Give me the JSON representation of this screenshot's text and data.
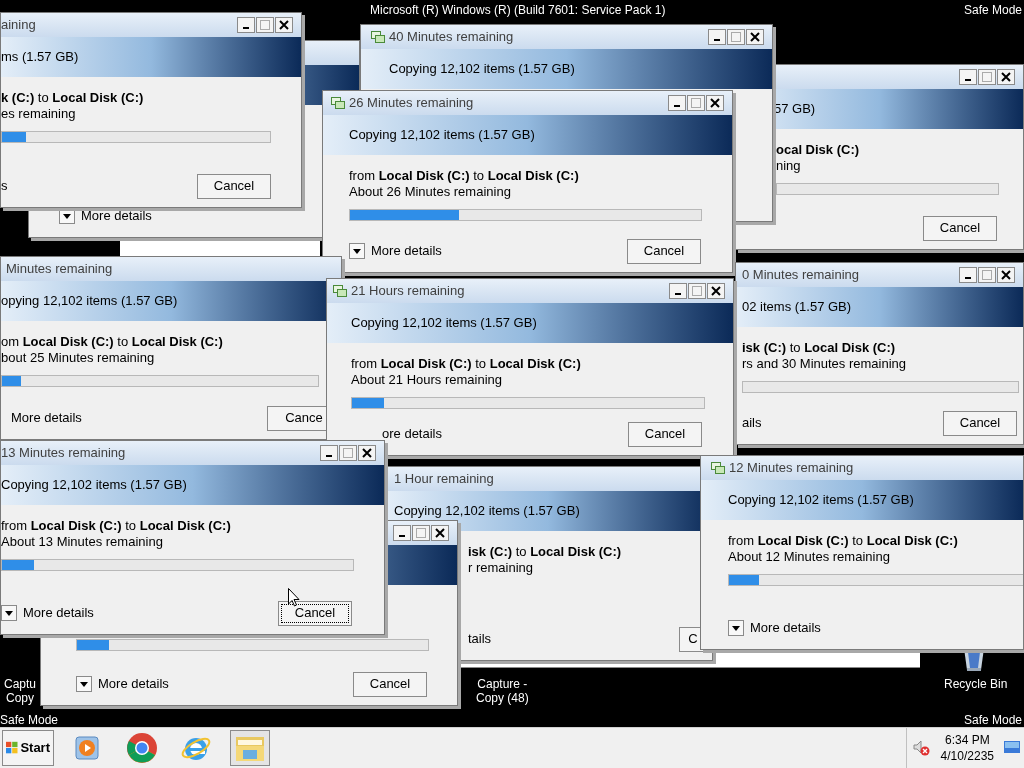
{
  "desktop": {
    "banner": "Microsoft (R) Windows (R) (Build 7601: Service Pack 1)",
    "safe_mode_labels": [
      "Safe Mode",
      "Safe Mode",
      "Safe Mode"
    ],
    "icons": [
      {
        "lines": [
          "Captu",
          "Copy"
        ]
      },
      {
        "lines": [
          "Capture -",
          "Copy (48)"
        ]
      },
      {
        "lines": [
          "Recycle Bin"
        ]
      }
    ]
  },
  "dialogs": [
    {
      "details": "More details"
    },
    {
      "header": "57 GB)",
      "source": "**ocal Disk (C:)**",
      "remaining": "ning",
      "cancel": "Cancel",
      "focused": false
    },
    {
      "title": "40 Minutes remaining",
      "header": "Copying 12,102 items (1.57 GB)"
    },
    {
      "title": "aining",
      "header": "ms (1.57 GB)",
      "source": "**k (C:)** to **Local Disk (C:)**",
      "remaining": "es remaining",
      "level": 0.09,
      "details": "s",
      "cancel": "Cancel",
      "focused": false
    },
    {
      "title": "26 Minutes remaining",
      "header": "Copying 12,102 items (1.57 GB)",
      "source": "from **Local Disk (C:)** to **Local Disk (C:)**",
      "remaining": "About 26 Minutes remaining",
      "level": 0.31,
      "details": "More details",
      "cancel": "Cancel",
      "focused": false
    },
    {
      "title": "Minutes remaining",
      "header": "opying 12,102 items (1.57 GB)",
      "source": "om **Local Disk (C:)** to **Local Disk (C:)**",
      "remaining": "bout 25 Minutes remaining",
      "level": 0.06,
      "details": "More details",
      "cancel": "Cance",
      "focused": false
    },
    {
      "title": "0 Minutes remaining",
      "header": "02 items (1.57 GB)",
      "source": "**isk (C:)** to **Local Disk (C:)**",
      "remaining": "rs and 30 Minutes remaining",
      "details": "ails",
      "cancel": "Cancel",
      "focused": false
    },
    {
      "title": "21 Hours remaining",
      "header": "Copying 12,102 items (1.57 GB)",
      "source": "from **Local Disk (C:)** to **Local Disk (C:)**",
      "remaining": "About 21 Hours remaining",
      "level": 0.09,
      "details": "ore details",
      "cancel": "Cancel",
      "focused": false
    },
    {
      "title": "1 Hour remaining",
      "header": "Copying 12,102 items (1.57 GB)",
      "source": "**isk (C:)** to **Local Disk (C:)**",
      "remaining": "r remaining",
      "details": "tails",
      "cancel": "C",
      "focused": false
    },
    {
      "title": "12 Minutes remaining",
      "header": "Copying 12,102 items (1.57 GB)",
      "source": "from **Local Disk (C:)** to **Local Disk (C:)**",
      "remaining": "About 12 Minutes remaining",
      "level": 0.1,
      "details": "More details"
    },
    {
      "level": 0.09,
      "details": "More details",
      "cancel": "Cancel",
      "focused": false
    },
    {
      "title": "13 Minutes remaining",
      "header": "Copying 12,102 items (1.57 GB)",
      "source": "from **Local Disk (C:)** to **Local Disk (C:)**",
      "remaining": "About 13 Minutes remaining",
      "level": 0.09,
      "details": "More details",
      "cancel": "Cancel",
      "focused": true
    }
  ],
  "taskbar": {
    "start": "Start",
    "apps": [
      {
        "selected": false
      },
      {
        "selected": false
      },
      {
        "selected": false
      },
      {
        "selected": true
      }
    ],
    "time": "6:34 PM",
    "date": "4/10/2235"
  }
}
